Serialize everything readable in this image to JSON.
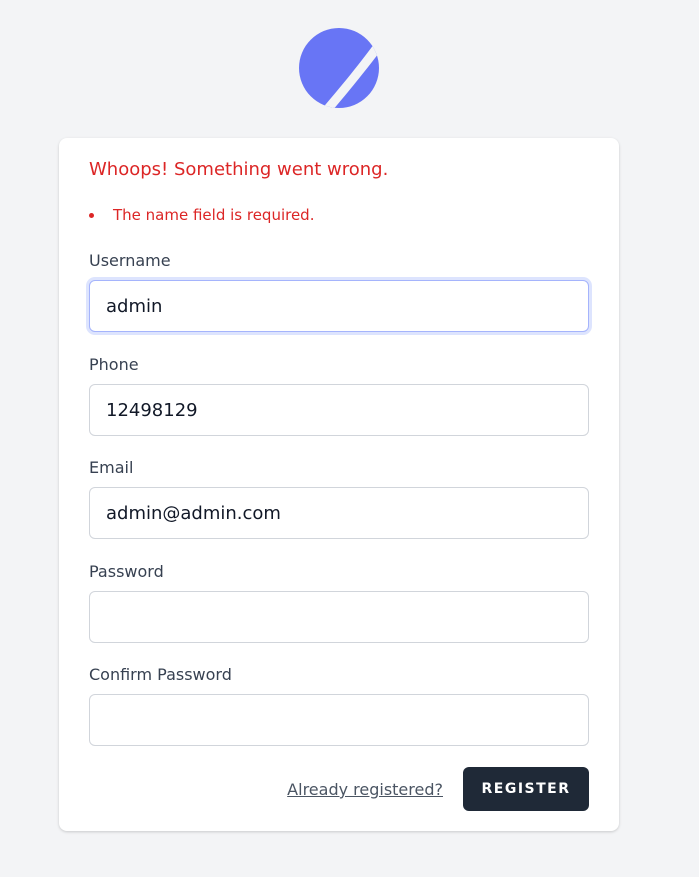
{
  "brand": {
    "logo_icon": "jetstream-logo-icon",
    "logo_color": "#6875f5"
  },
  "errors": {
    "title": "Whoops! Something went wrong.",
    "items": [
      "The name field is required."
    ]
  },
  "form": {
    "username": {
      "label": "Username",
      "value": "admin",
      "placeholder": ""
    },
    "phone": {
      "label": "Phone",
      "value": "12498129",
      "placeholder": ""
    },
    "email": {
      "label": "Email",
      "value": "admin@admin.com",
      "placeholder": ""
    },
    "password": {
      "label": "Password",
      "value": "",
      "placeholder": ""
    },
    "confirm_password": {
      "label": "Confirm Password",
      "value": "",
      "placeholder": ""
    }
  },
  "actions": {
    "login_link": "Already registered?",
    "register_label": "REGISTER"
  },
  "colors": {
    "background": "#f3f4f6",
    "error": "#dc2626",
    "button": "#1f2937",
    "focus_ring": "#a5b4fc"
  }
}
